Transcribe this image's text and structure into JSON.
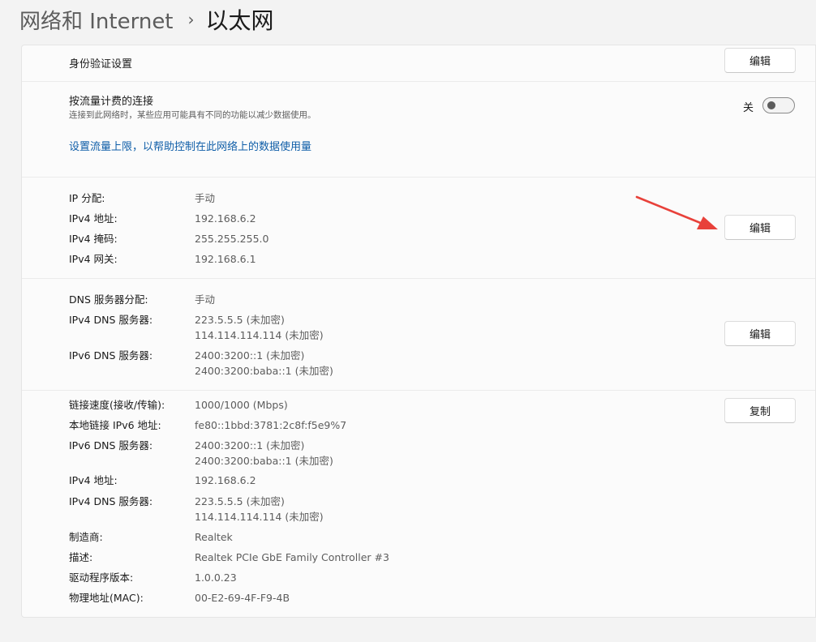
{
  "breadcrumb": {
    "parent": "网络和 Internet",
    "separator": "›",
    "current": "以太网"
  },
  "auth": {
    "title": "身份验证设置",
    "edit_label": "编辑"
  },
  "metered": {
    "title": "按流量计费的连接",
    "subtitle": "连接到此网络时，某些应用可能具有不同的功能以减少数据使用。",
    "toggle_state_label": "关",
    "toggle_on": false,
    "link": "设置流量上限，以帮助控制在此网络上的数据使用量"
  },
  "ip": {
    "edit_label": "编辑",
    "rows": [
      {
        "key": "IP 分配:",
        "value": "手动"
      },
      {
        "key": "IPv4 地址:",
        "value": "192.168.6.2"
      },
      {
        "key": "IPv4 掩码:",
        "value": "255.255.255.0"
      },
      {
        "key": "IPv4 网关:",
        "value": "192.168.6.1"
      }
    ]
  },
  "dns": {
    "edit_label": "编辑",
    "assignment": {
      "key": "DNS 服务器分配:",
      "value": "手动"
    },
    "ipv4": {
      "key": "IPv4 DNS 服务器:",
      "line1": "223.5.5.5 (未加密)",
      "line2": "114.114.114.114 (未加密)"
    },
    "ipv6": {
      "key": "IPv6 DNS 服务器:",
      "line1": "2400:3200::1 (未加密)",
      "line2": "2400:3200:baba::1 (未加密)"
    }
  },
  "props": {
    "copy_label": "复制",
    "link_speed": {
      "key": "链接速度(接收/传输):",
      "value": "1000/1000 (Mbps)"
    },
    "link_local_ipv6": {
      "key": "本地链接 IPv6 地址:",
      "value": "fe80::1bbd:3781:2c8f:f5e9%7"
    },
    "ipv6_dns": {
      "key": "IPv6 DNS 服务器:",
      "line1": "2400:3200::1 (未加密)",
      "line2": "2400:3200:baba::1 (未加密)"
    },
    "ipv4_address": {
      "key": "IPv4 地址:",
      "value": "192.168.6.2"
    },
    "ipv4_dns": {
      "key": "IPv4 DNS 服务器:",
      "line1": "223.5.5.5 (未加密)",
      "line2": "114.114.114.114 (未加密)"
    },
    "manufacturer": {
      "key": "制造商:",
      "value": "Realtek"
    },
    "description": {
      "key": "描述:",
      "value": "Realtek PCIe GbE Family Controller #3"
    },
    "driver_version": {
      "key": "驱动程序版本:",
      "value": "1.0.0.23"
    },
    "mac": {
      "key": "物理地址(MAC):",
      "value": "00-E2-69-4F-F9-4B"
    }
  },
  "colors": {
    "annotation_arrow": "#e8413a",
    "link": "#0f5ea8"
  }
}
